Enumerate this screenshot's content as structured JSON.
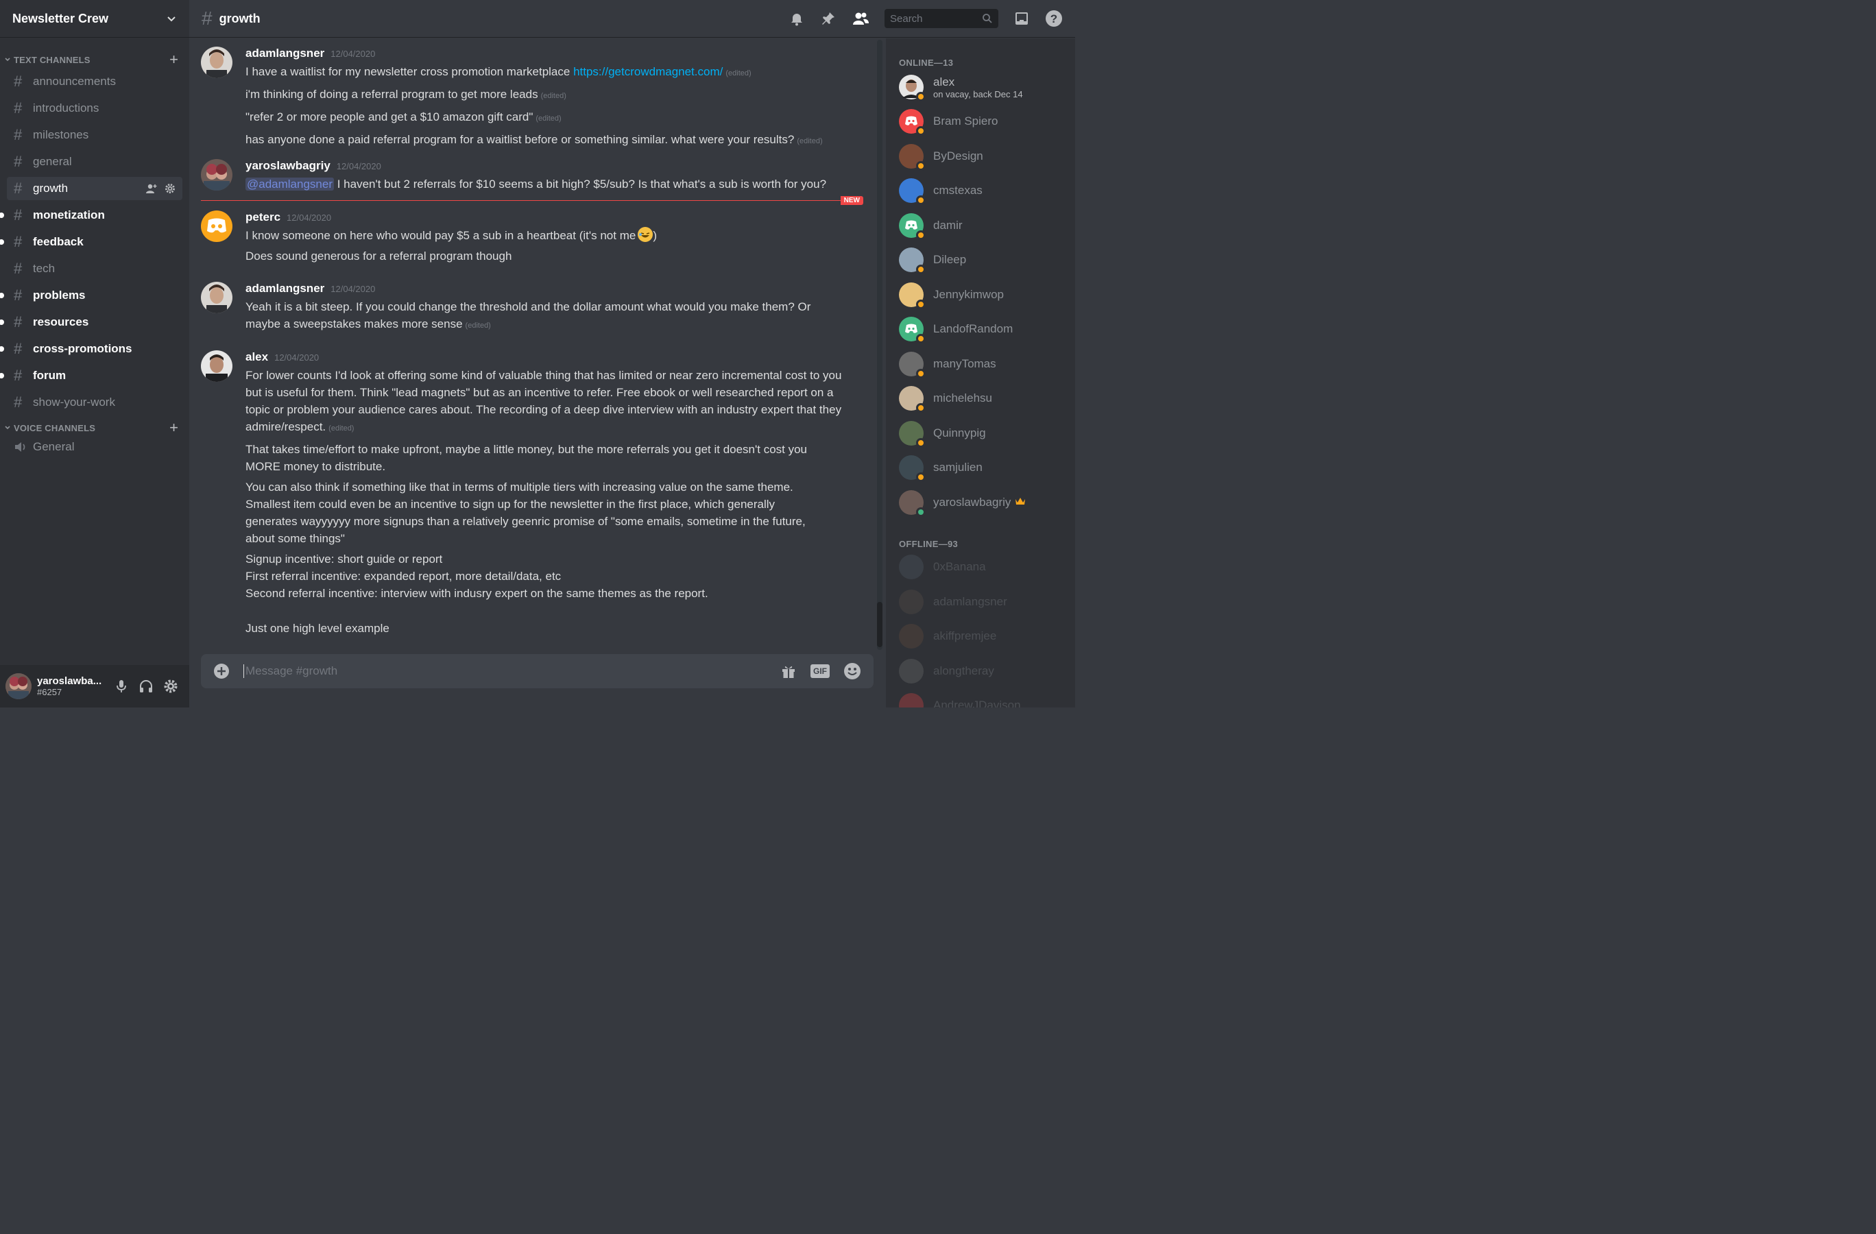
{
  "server": {
    "name": "Newsletter Crew"
  },
  "text_category": "TEXT CHANNELS",
  "voice_category": "VOICE CHANNELS",
  "channels": [
    {
      "label": "announcements"
    },
    {
      "label": "introductions"
    },
    {
      "label": "milestones"
    },
    {
      "label": "general"
    },
    {
      "label": "growth"
    },
    {
      "label": "monetization"
    },
    {
      "label": "feedback"
    },
    {
      "label": "tech"
    },
    {
      "label": "problems"
    },
    {
      "label": "resources"
    },
    {
      "label": "cross-promotions"
    },
    {
      "label": "forum"
    },
    {
      "label": "show-your-work"
    }
  ],
  "voice_channels": [
    {
      "label": "General"
    }
  ],
  "user": {
    "name": "yaroslawba...",
    "tag": "#6257"
  },
  "topbar": {
    "channel": "growth",
    "search_placeholder": "Search"
  },
  "messages": [
    {
      "author": "adamlangsner",
      "timestamp": "12/04/2020",
      "lines": [
        {
          "text": "I have a waitlist for my newsletter cross promotion marketplace ",
          "link": "https://getcrowdmagnet.com/",
          "edited": "(edited)"
        },
        {
          "text": "i'm thinking of doing a referral program to get more leads",
          "edited": "(edited)"
        },
        {
          "text": "\"refer 2 or more people and get a $10 amazon gift card\"",
          "edited": "(edited)"
        },
        {
          "text": "has anyone done a paid referral program for a waitlist before or something similar. what were your results?",
          "edited": "(edited)"
        }
      ]
    },
    {
      "author": "yaroslawbagriy",
      "timestamp": "12/04/2020",
      "mention": "@adamlangsner",
      "text": " I haven't but 2 referrals for $10 seems a bit high? $5/sub? Is that what's a sub is worth for you?"
    },
    {
      "author": "peterc",
      "timestamp": "12/04/2020",
      "lines": [
        {
          "text": "I know someone on here who would pay $5 a sub in a heartbeat (it's not me",
          "after": ")"
        },
        {
          "text": "Does sound generous for a referral program though"
        }
      ]
    },
    {
      "author": "adamlangsner",
      "timestamp": "12/04/2020",
      "lines": [
        {
          "text": "Yeah it is a bit steep. If you could change the threshold and the dollar amount what would you make them? Or maybe a sweepstakes makes more sense",
          "edited": "(edited)"
        }
      ]
    },
    {
      "author": "alex",
      "timestamp": "12/04/2020",
      "lines": [
        {
          "text": "For lower counts I'd look at offering some kind of valuable thing that has limited or near zero incremental cost to you but is useful for them. Think \"lead magnets\" but as an incentive to refer. Free ebook or well researched report on a topic or problem your audience cares about. The recording of a deep dive interview with an industry expert that they admire/respect.",
          "edited": "(edited)"
        },
        {
          "text": "That takes time/effort to make upfront, maybe a little money, but the more referrals you get it doesn't cost you MORE money to distribute."
        },
        {
          "text": "You can also think if something like that in terms of multiple tiers with increasing value on the same theme. Smallest item could even be an incentive to sign up for the newsletter in the first place, which generally generates wayyyyyy more signups than a relatively geenric promise of \"some emails, sometime in the future, about some things\""
        },
        {
          "text": "Signup incentive: short guide or report"
        },
        {
          "text": "First referral incentive: expanded report, more detail/data, etc"
        },
        {
          "text": "Second referral incentive: interview with indusry expert on the same themes as the report."
        },
        {
          "text": "Just one high level example"
        }
      ]
    }
  ],
  "new_badge": "NEW",
  "composer": {
    "placeholder": "Message #growth",
    "gif_label": "GIF"
  },
  "members": {
    "online_title": "ONLINE—13",
    "online": [
      {
        "name": "alex",
        "status": "on vacay, back Dec 14",
        "avatar_color": "#4a3b33"
      },
      {
        "name": "Bram Spiero",
        "avatar_color": "#f04747",
        "discord": true
      },
      {
        "name": "ByDesign",
        "avatar_color": "#7a4a36"
      },
      {
        "name": "cmstexas",
        "avatar_color": "#3a7bd5"
      },
      {
        "name": "damir",
        "avatar_color": "#43b581",
        "discord": true
      },
      {
        "name": "Dileep",
        "avatar_color": "#8fa3b5"
      },
      {
        "name": "Jennykimwop",
        "avatar_color": "#e8c27a"
      },
      {
        "name": "LandofRandom",
        "avatar_color": "#43b581",
        "discord": true
      },
      {
        "name": "manyTomas",
        "avatar_color": "#6c6c6c"
      },
      {
        "name": "michelehsu",
        "avatar_color": "#c9b59a"
      },
      {
        "name": "Quinnypig",
        "avatar_color": "#5a6f4f"
      },
      {
        "name": "samjulien",
        "avatar_color": "#3d4a52"
      },
      {
        "name": "yaroslawbagriy",
        "avatar_color": "#6b5a55",
        "online": true,
        "crown": true
      }
    ],
    "offline_title": "OFFLINE—93",
    "offline": [
      {
        "name": "0xBanana",
        "avatar_color": "#55626b"
      },
      {
        "name": "adamlangsner",
        "avatar_color": "#5d534c"
      },
      {
        "name": "akiffpremjee",
        "avatar_color": "#6b4f3f"
      },
      {
        "name": "alongtheray",
        "avatar_color": "#777777"
      },
      {
        "name": "AndrewJDavison",
        "avatar_color": "#f04747"
      }
    ]
  },
  "colors": {
    "accent": "#7289da",
    "link": "#00b0f4",
    "new": "#f04747",
    "idle": "#faa61a",
    "online": "#43b581"
  }
}
